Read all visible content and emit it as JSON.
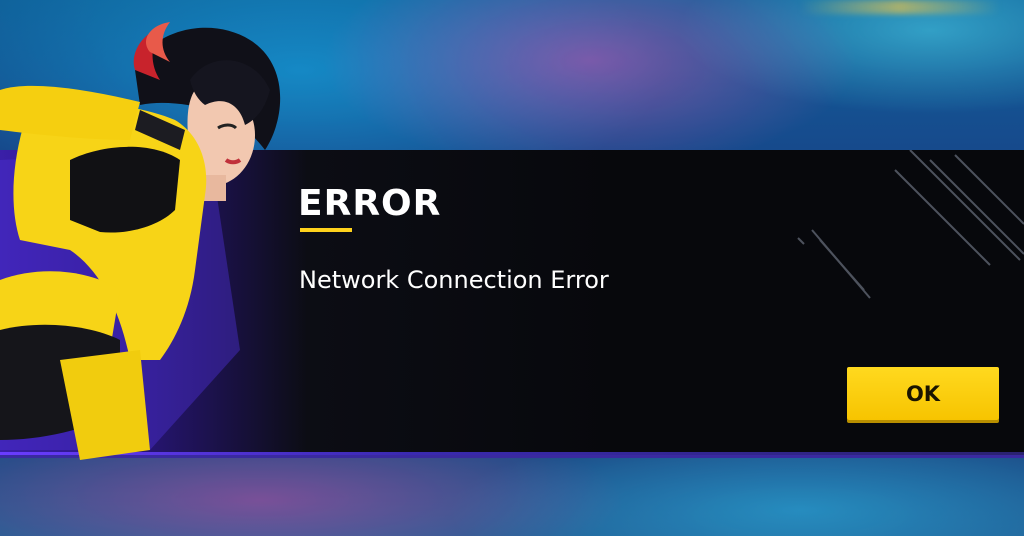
{
  "dialog": {
    "title": "ERROR",
    "message": "Network Connection Error",
    "ok_label": "OK"
  },
  "theme": {
    "accent": "#ffd21c",
    "banner": "#07080c",
    "banner_edge": "#6a3cff"
  },
  "icons": {
    "character": "female-character-yellow-jacket-illustration",
    "decoration": "diagonal-slash-lines"
  }
}
